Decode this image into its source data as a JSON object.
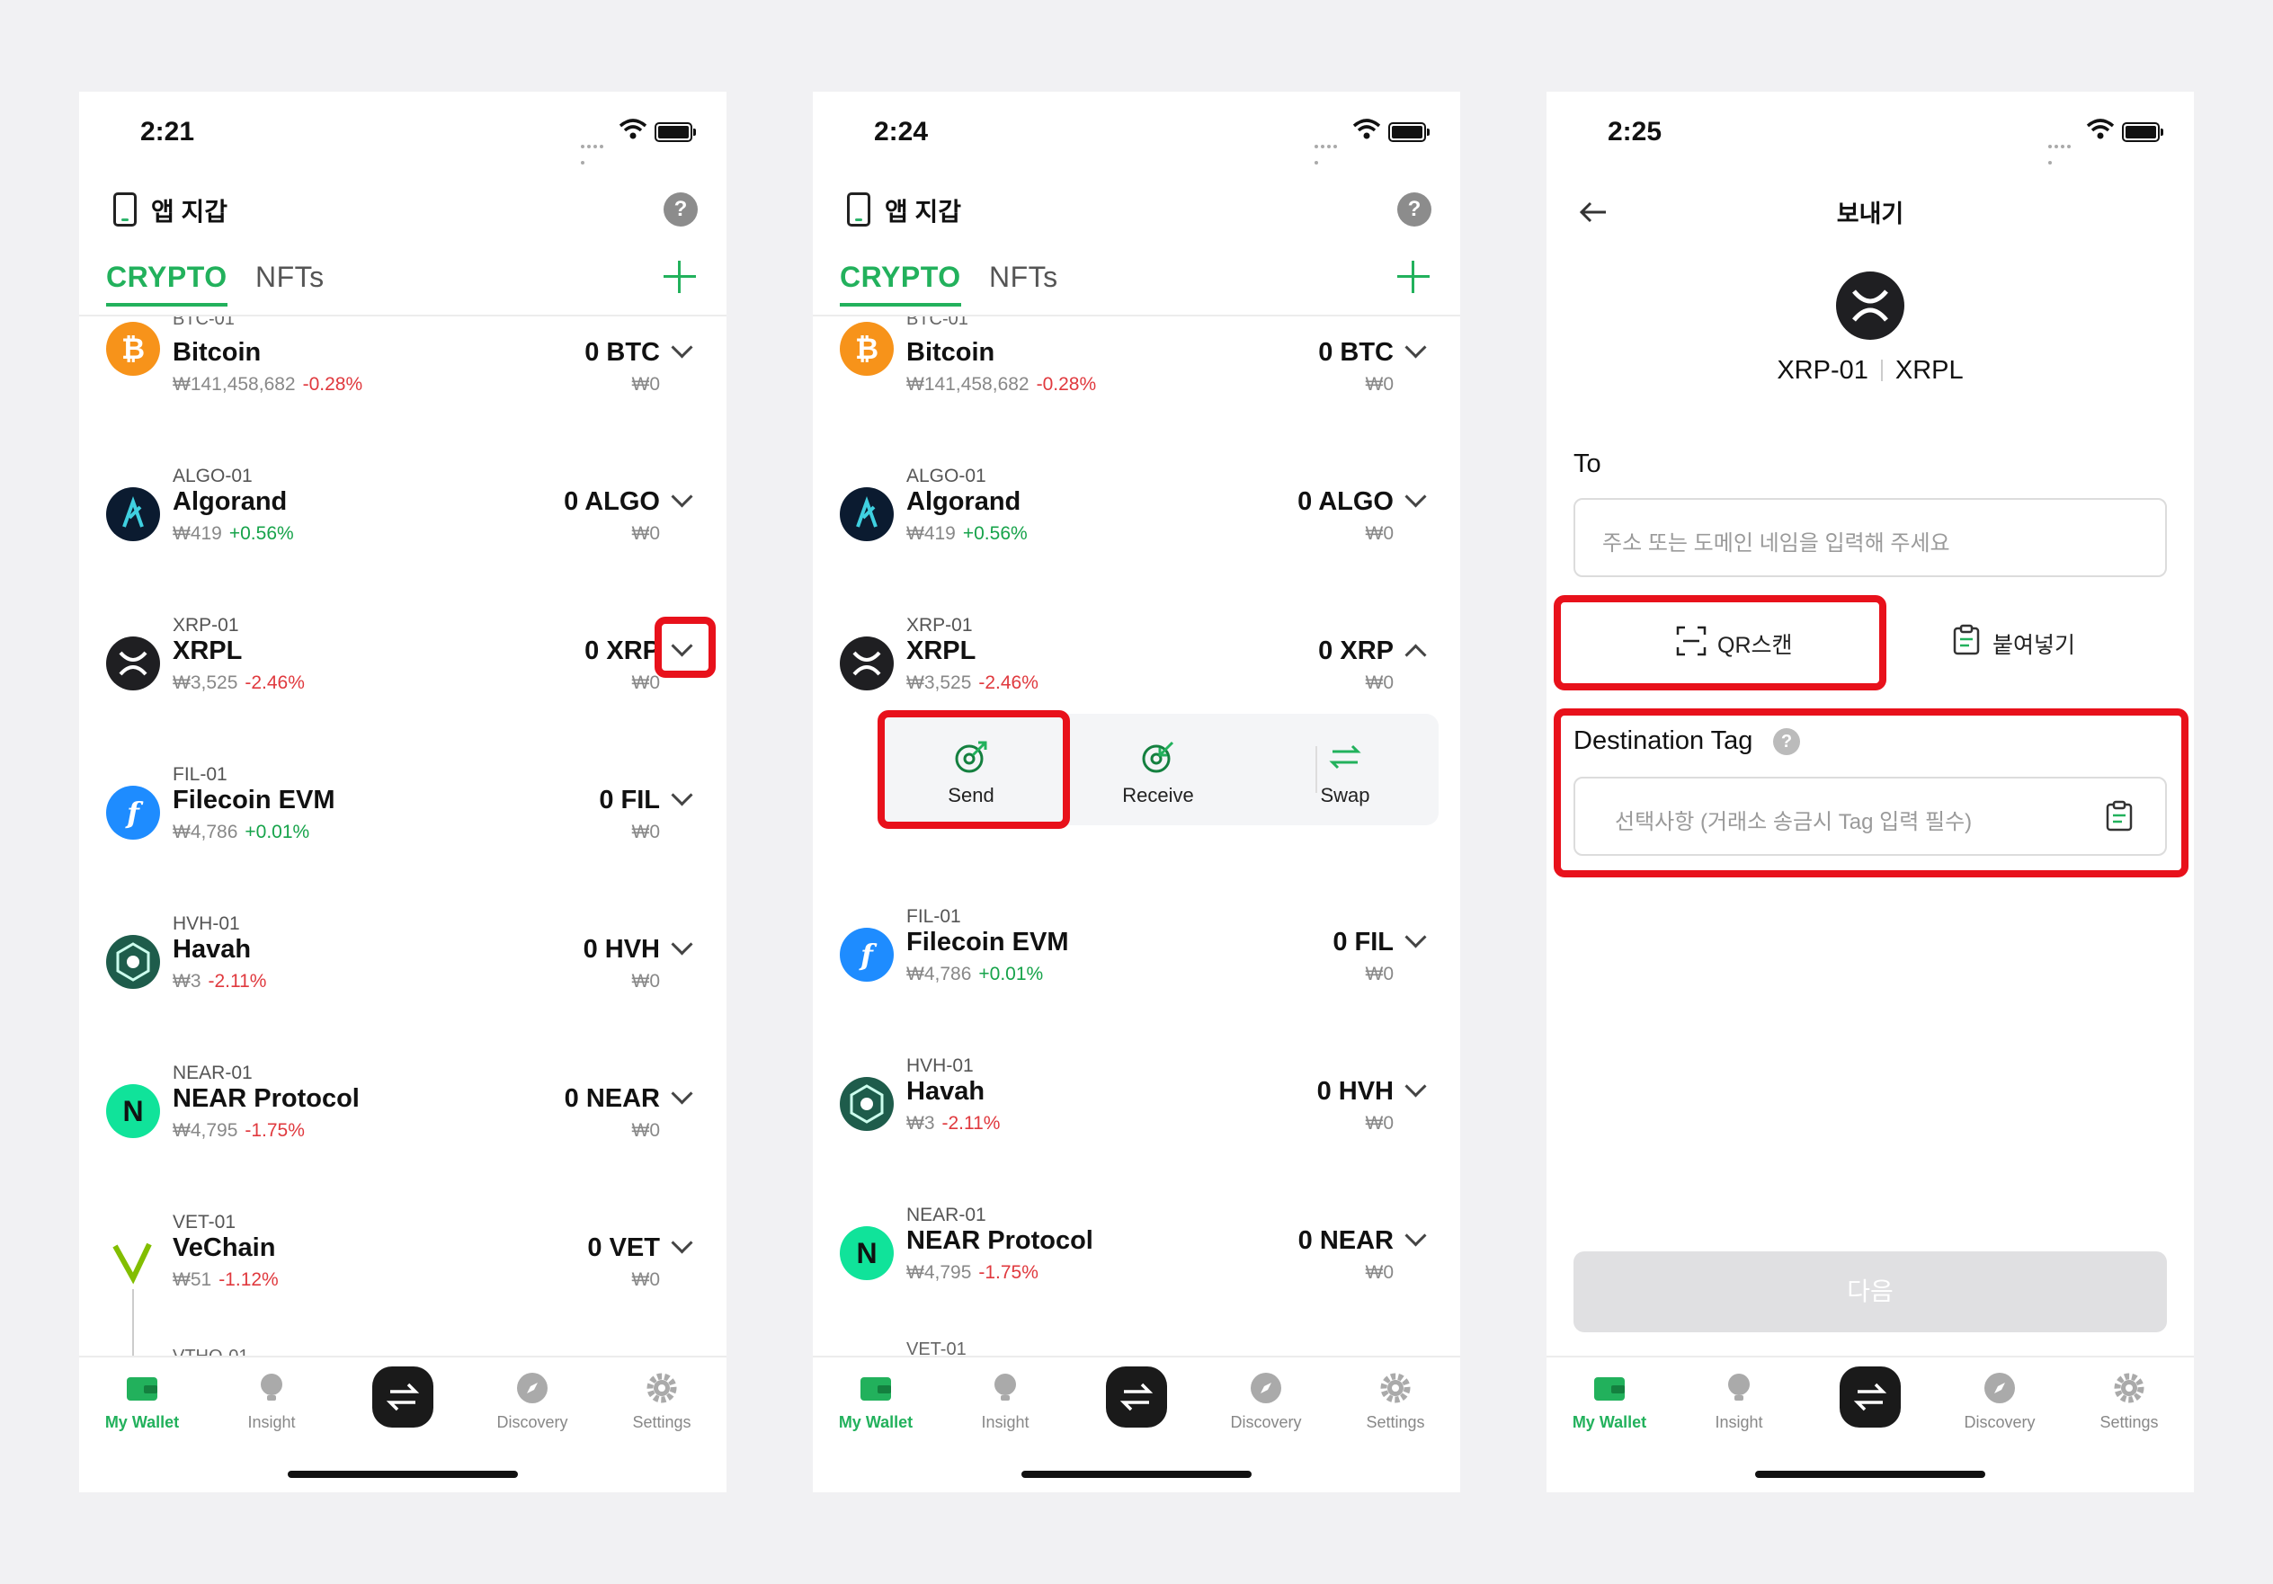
{
  "colors": {
    "accent": "#22b15c",
    "negative": "#e0393e",
    "positive": "#16a34a",
    "highlight": "#e8111b"
  },
  "screens": [
    {
      "time": "2:21",
      "header_title": "앱 지갑",
      "tabs": [
        "CRYPTO",
        "NFTs"
      ],
      "cut_top_label": "BTC-01",
      "assets": [
        {
          "symbol": "BTC-01",
          "name": "Bitcoin",
          "price": "₩141,458,682",
          "change": "-0.28%",
          "amount": "0 BTC",
          "fiat": "₩0"
        },
        {
          "symbol": "ALGO-01",
          "name": "Algorand",
          "price": "₩419",
          "change": "+0.56%",
          "amount": "0 ALGO",
          "fiat": "₩0"
        },
        {
          "symbol": "XRP-01",
          "name": "XRPL",
          "price": "₩3,525",
          "change": "-2.46%",
          "amount": "0 XRP",
          "fiat": "₩0"
        },
        {
          "symbol": "FIL-01",
          "name": "Filecoin EVM",
          "price": "₩4,786",
          "change": "+0.01%",
          "amount": "0 FIL",
          "fiat": "₩0"
        },
        {
          "symbol": "HVH-01",
          "name": "Havah",
          "price": "₩3",
          "change": "-2.11%",
          "amount": "0 HVH",
          "fiat": "₩0"
        },
        {
          "symbol": "NEAR-01",
          "name": "NEAR Protocol",
          "price": "₩4,795",
          "change": "-1.75%",
          "amount": "0 NEAR",
          "fiat": "₩0"
        },
        {
          "symbol": "VET-01",
          "name": "VeChain",
          "price": "₩51",
          "change": "-1.12%",
          "amount": "0 VET",
          "fiat": "₩0"
        }
      ],
      "cut_bottom_label": "VTHO-01"
    },
    {
      "time": "2:24",
      "header_title": "앱 지갑",
      "tabs": [
        "CRYPTO",
        "NFTs"
      ],
      "cut_top_label": "BTC-01",
      "actions": [
        "Send",
        "Receive",
        "Swap"
      ],
      "cut_bottom_label": "VET-01"
    },
    {
      "time": "2:25",
      "title": "보내기",
      "coin_id": "XRP-01",
      "network": "XRPL",
      "to_label": "To",
      "to_placeholder": "주소 또는 도메인 네임을 입력해 주세요",
      "qr_label": "QR스캔",
      "paste_label": "붙여넣기",
      "dest_tag_label": "Destination Tag",
      "dest_tag_placeholder": "선택사항 (거래소 송금시 Tag 입력 필수)",
      "next_label": "다음"
    }
  ],
  "tabbar": [
    "My Wallet",
    "Insight",
    "Discovery",
    "Settings"
  ]
}
